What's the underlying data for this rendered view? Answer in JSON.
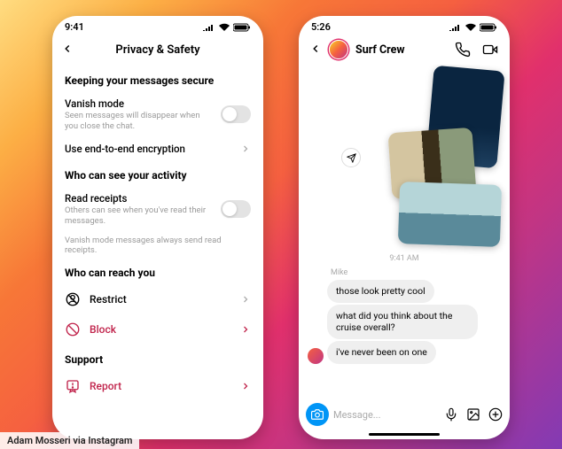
{
  "credit": "Adam Mosseri via Instagram",
  "phone1": {
    "time": "9:41",
    "header_title": "Privacy & Safety",
    "sect1": "Keeping your messages secure",
    "vanish": {
      "label": "Vanish mode",
      "sub": "Seen messages will disappear when you close the chat."
    },
    "e2e": {
      "label": "Use end-to-end encryption"
    },
    "sect2": "Who can see your activity",
    "receipts": {
      "label": "Read receipts",
      "sub": "Others can see when you've read their messages."
    },
    "note": "Vanish mode messages always send read receipts.",
    "sect3": "Who can reach you",
    "restrict": "Restrict",
    "block": "Block",
    "sect4": "Support",
    "report": "Report"
  },
  "phone2": {
    "time": "5:26",
    "chat_title": "Surf Crew",
    "timestamp": "9:41 AM",
    "sender": "Mike",
    "msg1": "those look pretty cool",
    "msg2": "what did you think about the cruise overall?",
    "msg3": "i've never been on one",
    "placeholder": "Message..."
  }
}
